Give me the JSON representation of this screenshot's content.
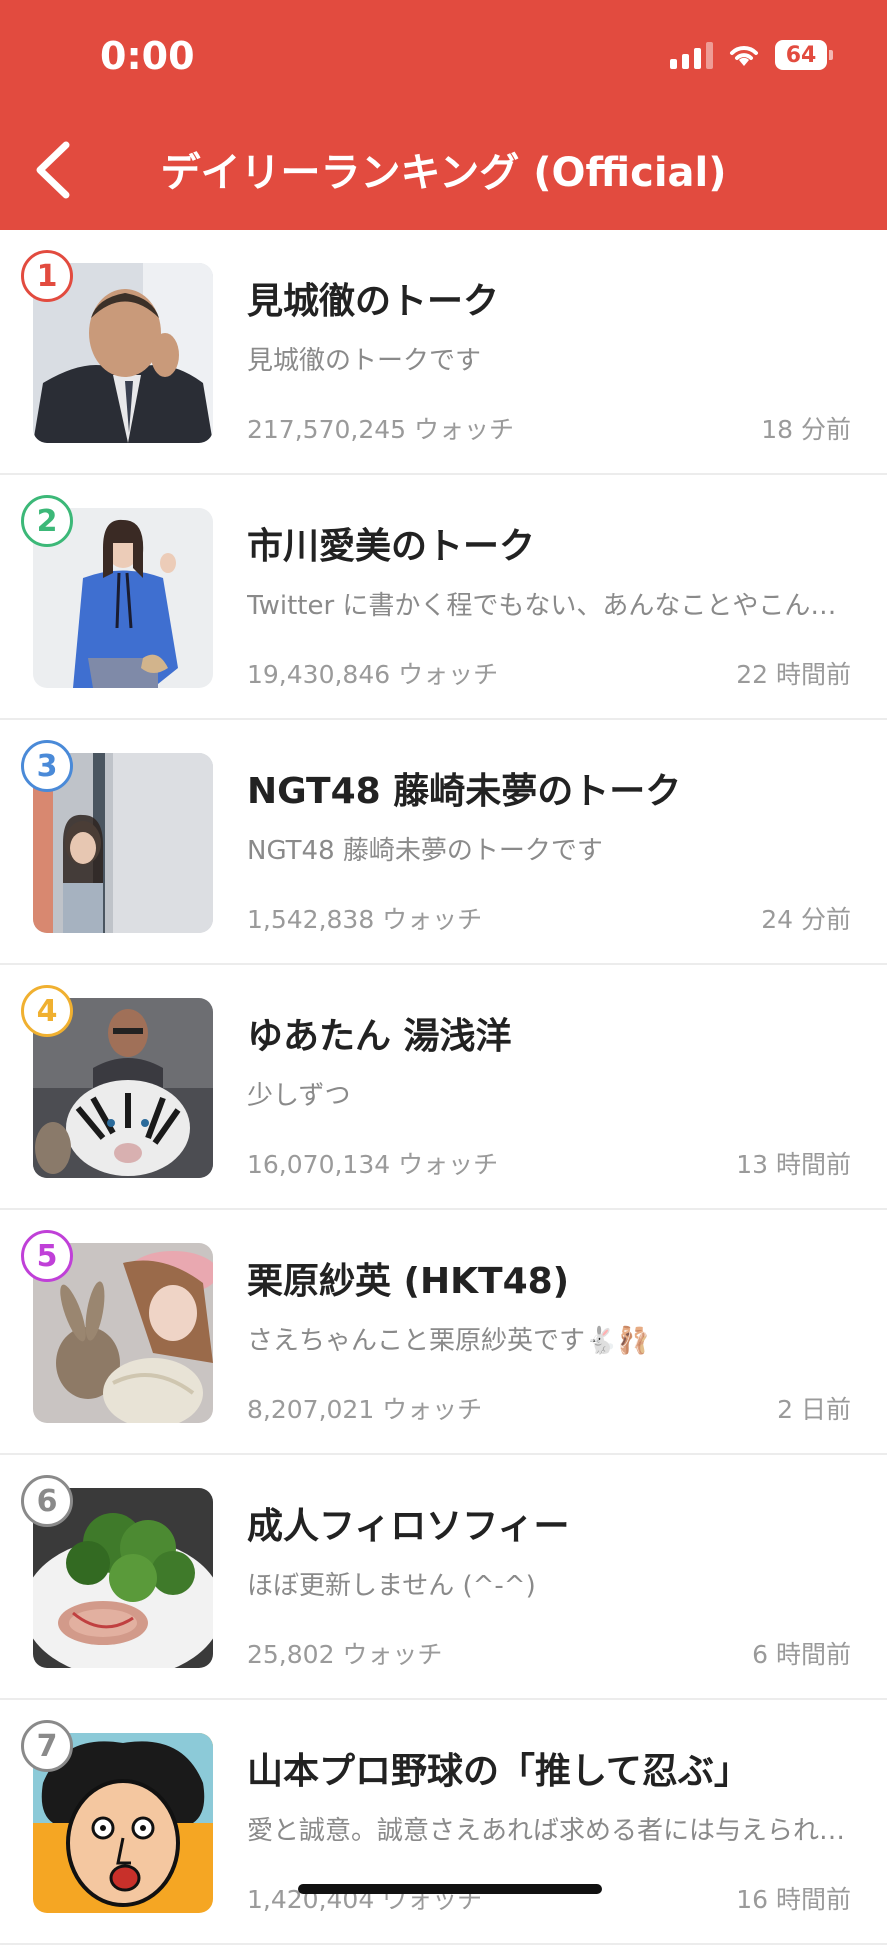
{
  "status_bar": {
    "time": "0:00",
    "battery": "64"
  },
  "header": {
    "title": "デイリーランキング (Official)"
  },
  "items": [
    {
      "rank": "1",
      "rank_color": "#e24b3f",
      "title": "見城徹のトーク",
      "description": "見城徹のトークです",
      "watch": "217,570,245 ウォッチ",
      "time": "18 分前"
    },
    {
      "rank": "2",
      "rank_color": "#3cb878",
      "title": "市川愛美のトーク",
      "description": "Twitter に書かく程でもない、あんなことやこん…",
      "watch": "19,430,846 ウォッチ",
      "time": "22 時間前"
    },
    {
      "rank": "3",
      "rank_color": "#4a8ad8",
      "title": "NGT48 藤崎未夢のトーク",
      "description": "NGT48 藤崎未夢のトークです",
      "watch": "1,542,838 ウォッチ",
      "time": "24 分前"
    },
    {
      "rank": "4",
      "rank_color": "#f0b030",
      "title": "ゆあたん 湯浅洋",
      "description": "少しずつ",
      "watch": "16,070,134 ウォッチ",
      "time": "13 時間前"
    },
    {
      "rank": "5",
      "rank_color": "#c040d8",
      "title": "栗原紗英 (HKT48)",
      "description": "さえちゃんこと栗原紗英です🐇🩰",
      "watch": "8,207,021 ウォッチ",
      "time": "2 日前"
    },
    {
      "rank": "6",
      "rank_color": "#8a8a8a",
      "title": "成人フィロソフィー",
      "description": "ほぼ更新しません (^-^)",
      "watch": "25,802 ウォッチ",
      "time": "6 時間前"
    },
    {
      "rank": "7",
      "rank_color": "#8a8a8a",
      "title": "山本プロ野球の「推して忍ぶ」",
      "description": "愛と誠意。誠意さえあれば求める者には与えられ…",
      "watch": "1,420,404 ウォッチ",
      "time": "16 時間前"
    }
  ]
}
